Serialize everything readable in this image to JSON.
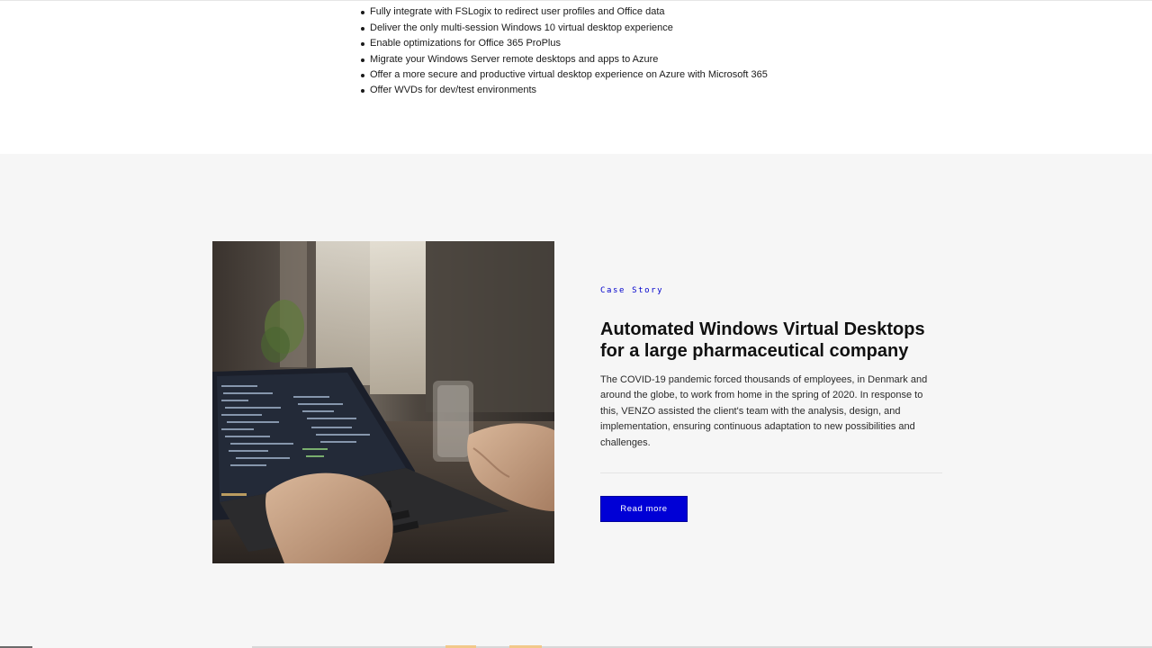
{
  "features": [
    "Fully integrate with FSLogix to redirect user profiles and Office data",
    "Deliver the only multi-session Windows 10 virtual desktop experience",
    "Enable optimizations for Office 365 ProPlus",
    "Migrate your Windows Server remote desktops and apps to Azure",
    "Offer a more secure and productive virtual desktop experience on Azure with Microsoft 365",
    "Offer WVDs for dev/test environments"
  ],
  "case": {
    "eyebrow": "Case Story",
    "title_line1": "Automated Windows Virtual Desktops",
    "title_line2": "for a large pharmaceutical company",
    "description": "The COVID-19 pandemic forced thousands of employees, in Denmark and around the globe, to work from home in the spring of 2020. In response to this, VENZO assisted the client's team with the analysis, design, and implementation, ensuring continuous adaptation to new possibilities and challenges.",
    "button_label": "Read more"
  },
  "colors": {
    "accent": "#0000d6",
    "section_bg": "#f6f6f6"
  }
}
